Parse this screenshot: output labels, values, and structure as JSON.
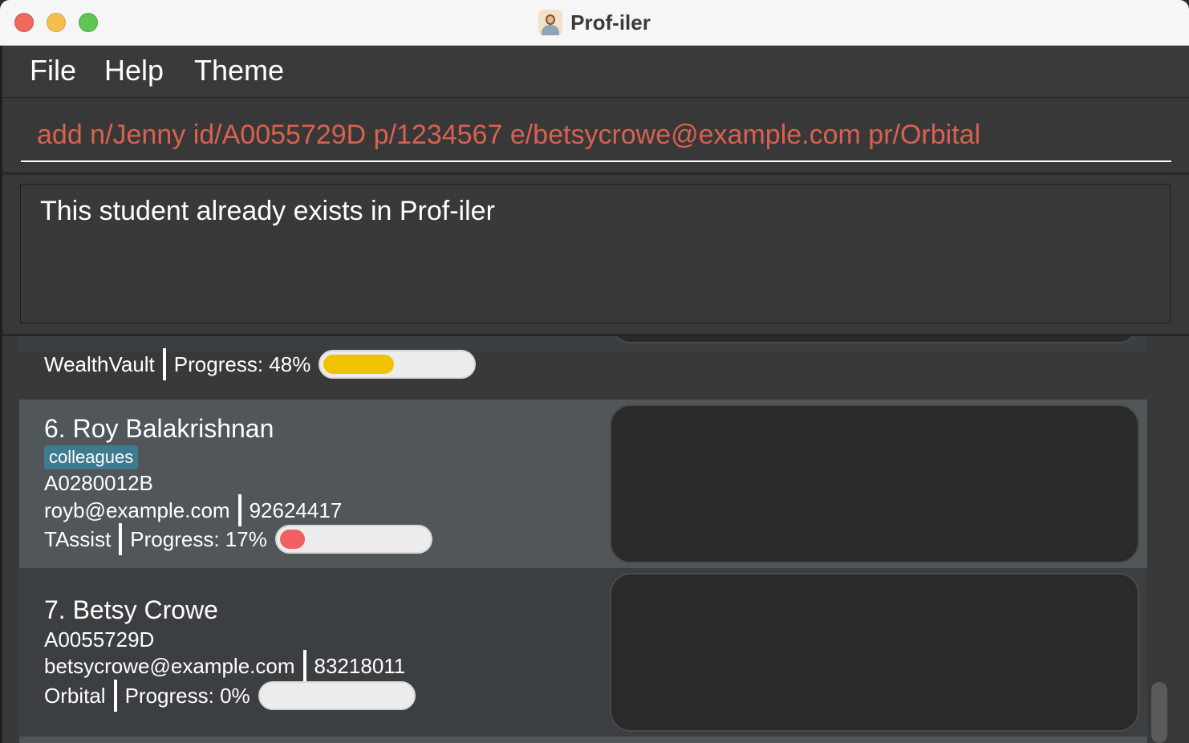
{
  "window": {
    "title": "Prof-iler",
    "controls": [
      "close",
      "minimize",
      "zoom"
    ]
  },
  "menu": {
    "items": [
      {
        "label": "File"
      },
      {
        "label": "Help"
      },
      {
        "label": "Theme"
      }
    ]
  },
  "command": {
    "value": "add n/Jenny id/A0055729D p/1234567 e/betsycrowe@example.com pr/Orbital",
    "color": "#d9614f"
  },
  "result": {
    "message": "This student already exists in Prof-iler"
  },
  "students": [
    {
      "index_name": "",
      "project": "WealthVault",
      "progress_label": "Progress: 48%",
      "progress": 48,
      "progress_color": "#f2c200"
    },
    {
      "index_name": "6. Roy Balakrishnan",
      "tag": "colleagues",
      "id": "A0280012B",
      "email": "royb@example.com",
      "phone": "92624417",
      "project": "TAssist",
      "progress_label": "Progress: 17%",
      "progress": 17,
      "progress_color": "#f06060"
    },
    {
      "index_name": "7. Betsy Crowe",
      "id": "A0055729D",
      "email": "betsycrowe@example.com",
      "phone": "83218011",
      "project": "Orbital",
      "progress_label": "Progress: 0%",
      "progress": 0,
      "progress_color": "#ececec"
    }
  ]
}
